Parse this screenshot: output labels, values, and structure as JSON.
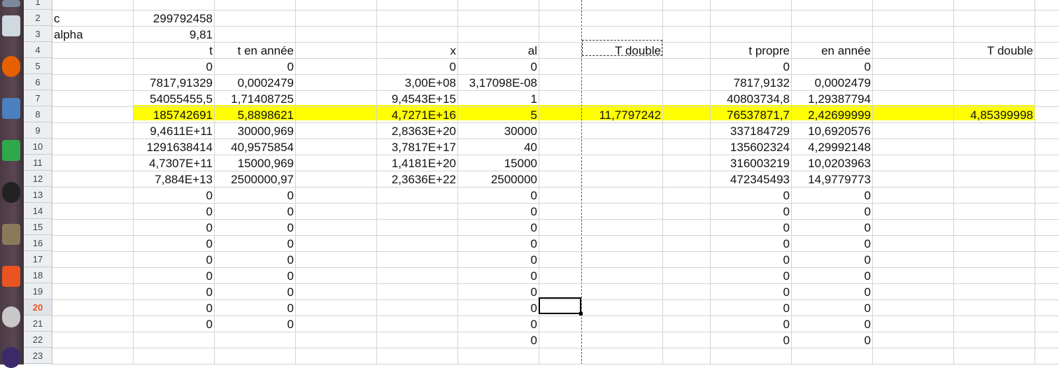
{
  "launcher": {
    "icons": [
      {
        "name": "files-icon",
        "color": "#7a8a9a"
      },
      {
        "name": "cube-icon",
        "color": "#d0d8e0"
      },
      {
        "name": "firefox-icon",
        "color": "#e66000"
      },
      {
        "name": "image-viewer-icon",
        "color": "#4a7fc0"
      },
      {
        "name": "libreoffice-calc-icon",
        "color": "#2fa84a"
      },
      {
        "name": "inkscape-icon",
        "color": "#222222"
      },
      {
        "name": "gimp-icon",
        "color": "#8a7a5a"
      },
      {
        "name": "ubuntu-software-icon",
        "color": "#e95420"
      },
      {
        "name": "settings-icon",
        "color": "#c8c8c8"
      },
      {
        "name": "moon-icon",
        "color": "#3a2a6a"
      }
    ]
  },
  "sheet": {
    "selected_row": "20",
    "rows": [
      "1",
      "2",
      "3",
      "4",
      "5",
      "6",
      "7",
      "8",
      "9",
      "10",
      "11",
      "12",
      "13",
      "14",
      "15",
      "16",
      "17",
      "18",
      "19",
      "20",
      "21",
      "22",
      "23"
    ],
    "highlight_color": "#ffff00",
    "cells": {
      "r2": {
        "a": "c",
        "b": "299792458"
      },
      "r3": {
        "a": "alpha",
        "b": "9,81"
      },
      "r4": {
        "b": "t",
        "c": "t en année",
        "e": "x",
        "f": "al",
        "g": "T double",
        "i": "t propre",
        "j": "en année",
        "l": "T double"
      },
      "r5": {
        "b": "0",
        "c": "0",
        "e": "0",
        "f": "0",
        "i": "0",
        "j": "0"
      },
      "r6": {
        "b": "7817,91329",
        "c": "0,0002479",
        "e": "3,00E+08",
        "f": "3,17098E-08",
        "i": "7817,9132",
        "j": "0,0002479"
      },
      "r7": {
        "b": "54055455,5",
        "c": "1,71408725",
        "e": "9,4543E+15",
        "f": "1",
        "i": "40803734,8",
        "j": "1,29387794"
      },
      "r8": {
        "b": "185742691",
        "c": "5,8898621",
        "e": "4,7271E+16",
        "f": "5",
        "g": "11,7797242",
        "i": "76537871,7",
        "j": "2,42699999",
        "l": "4,85399998"
      },
      "r9": {
        "b": "9,4611E+11",
        "c": "30000,969",
        "e": "2,8363E+20",
        "f": "30000",
        "i": "337184729",
        "j": "10,6920576"
      },
      "r10": {
        "b": "1291638414",
        "c": "40,9575854",
        "e": "3,7817E+17",
        "f": "40",
        "i": "135602324",
        "j": "4,29992148"
      },
      "r11": {
        "b": "4,7307E+11",
        "c": "15000,969",
        "e": "1,4181E+20",
        "f": "15000",
        "i": "316003219",
        "j": "10,0203963"
      },
      "r12": {
        "b": "7,884E+13",
        "c": "2500000,97",
        "e": "2,3636E+22",
        "f": "2500000",
        "i": "472345493",
        "j": "14,9779773"
      },
      "r13": {
        "b": "0",
        "c": "0",
        "f": "0",
        "i": "0",
        "j": "0"
      },
      "r14": {
        "b": "0",
        "c": "0",
        "f": "0",
        "i": "0",
        "j": "0"
      },
      "r15": {
        "b": "0",
        "c": "0",
        "f": "0",
        "i": "0",
        "j": "0"
      },
      "r16": {
        "b": "0",
        "c": "0",
        "f": "0",
        "i": "0",
        "j": "0"
      },
      "r17": {
        "b": "0",
        "c": "0",
        "f": "0",
        "i": "0",
        "j": "0"
      },
      "r18": {
        "b": "0",
        "c": "0",
        "f": "0",
        "i": "0",
        "j": "0"
      },
      "r19": {
        "b": "0",
        "c": "0",
        "f": "0",
        "i": "0",
        "j": "0"
      },
      "r20": {
        "b": "0",
        "c": "0",
        "f": "0",
        "i": "0",
        "j": "0"
      },
      "r21": {
        "b": "0",
        "c": "0",
        "f": "0",
        "i": "0",
        "j": "0"
      },
      "r22": {
        "f": "0",
        "i": "0",
        "j": "0"
      }
    }
  }
}
